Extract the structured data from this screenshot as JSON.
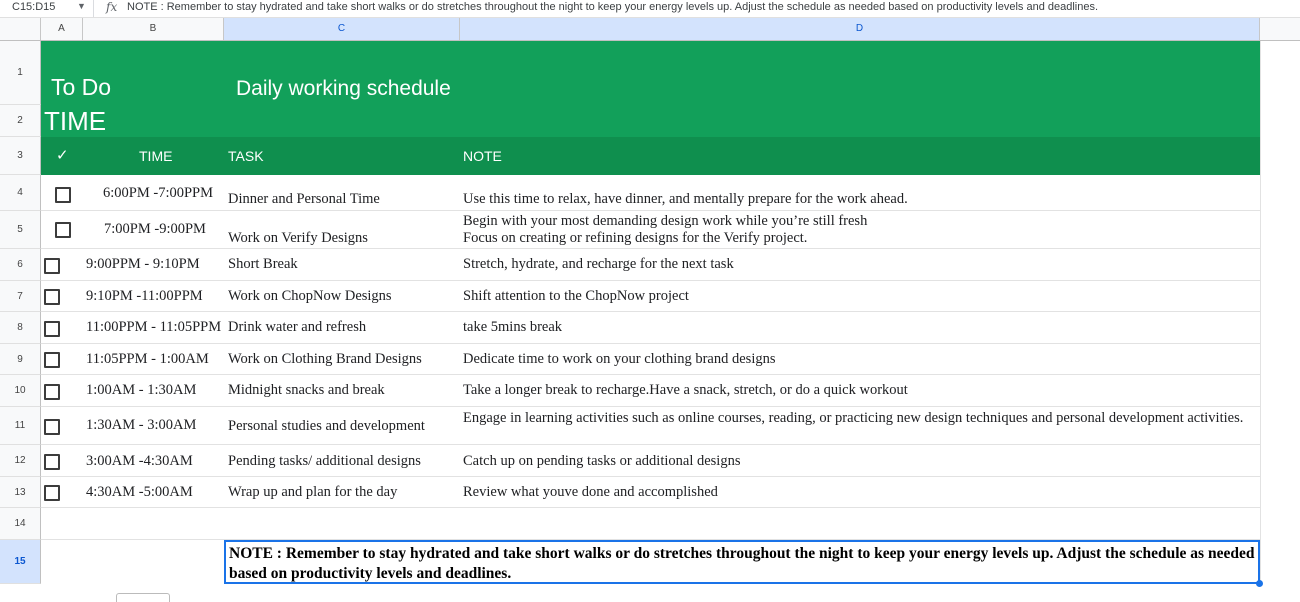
{
  "formula_bar": {
    "name_box": "C15:D15",
    "fx_icon": "fx-icon",
    "formula": "NOTE : Remember to stay hydrated and take short walks or do stretches throughout the night to keep your energy levels up. Adjust the schedule as needed based on productivity levels and deadlines."
  },
  "columns": [
    "A",
    "B",
    "C",
    "D"
  ],
  "rows": [
    "1",
    "2",
    "3",
    "4",
    "5",
    "6",
    "7",
    "8",
    "9",
    "10",
    "11",
    "12",
    "13",
    "14",
    "15"
  ],
  "header": {
    "to_do": "To Do",
    "time_big": "TIME",
    "title": "Daily working schedule",
    "check_mark": "✓",
    "col_time": "TIME",
    "col_task": "TASK",
    "col_note": "NOTE"
  },
  "schedule": [
    {
      "time": "6:00PM -7:00PPM",
      "task": "Dinner and Personal Time",
      "note": "Use this time to relax, have dinner, and mentally prepare for the work ahead.",
      "checked": false
    },
    {
      "time": "7:00PM -9:00PM",
      "task": "Work on Verify Designs",
      "note_line1": "Begin with your most demanding design work while you’re still fresh",
      "note_line2": "Focus on creating or refining designs for the Verify project.",
      "checked": false
    },
    {
      "time": "9:00PPM - 9:10PM",
      "task": "Short Break",
      "note": "Stretch, hydrate, and recharge for the next task",
      "checked": false
    },
    {
      "time": "9:10PM -11:00PPM",
      "task": "Work on ChopNow Designs",
      "note": "Shift attention to the ChopNow project",
      "checked": false
    },
    {
      "time": "11:00PPM - 11:05PPM",
      "task": "Drink water and refresh",
      "note": "take 5mins break",
      "checked": false
    },
    {
      "time": "11:05PPM - 1:00AM",
      "task": "Work on Clothing Brand Designs",
      "note": "Dedicate time to work on your clothing brand designs",
      "checked": false
    },
    {
      "time": "1:00AM - 1:30AM",
      "task": "Midnight snacks and break",
      "note": "Take a longer break to recharge.Have a snack, stretch, or do a quick workout",
      "checked": false
    },
    {
      "time": "1:30AM - 3:00AM",
      "task": "Personal studies and development",
      "note": "Engage in learning activities such as online courses, reading, or practicing new design techniques and personal development activities.",
      "checked": false
    },
    {
      "time": "3:00AM -4:30AM",
      "task": "Pending tasks/ additional designs",
      "note": "Catch up on pending tasks or additional designs",
      "checked": false
    },
    {
      "time": "4:30AM -5:00AM",
      "task": "Wrap up and plan for the day",
      "note": "Review what youve done and accomplished",
      "checked": false
    }
  ],
  "note_cell": {
    "text": "NOTE : Remember to stay hydrated and take short walks or do stretches throughout the night to keep your energy levels up. Adjust the schedule as needed based on productivity levels and deadlines."
  },
  "colors": {
    "green_band": "#12a05a",
    "green_header": "#0f8f4e",
    "selection": "#1a73e8"
  }
}
